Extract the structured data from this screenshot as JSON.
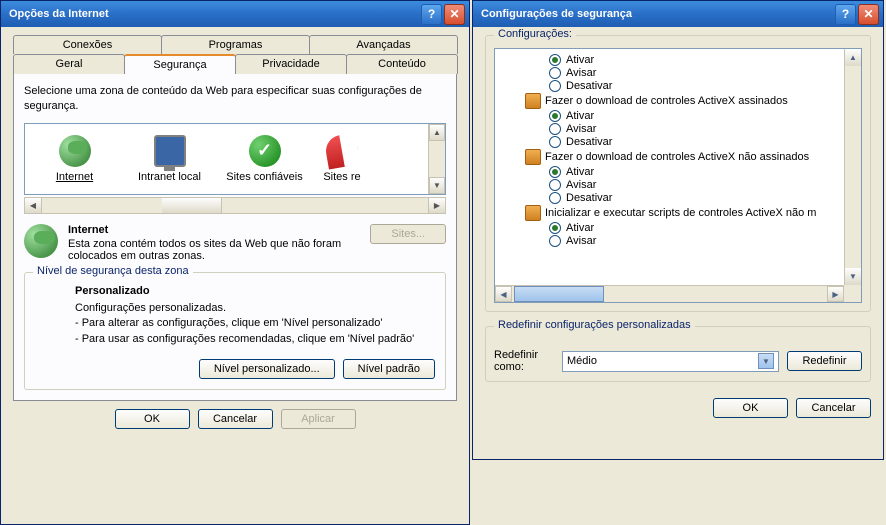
{
  "win1": {
    "title": "Opções da Internet",
    "tabs_top": [
      "Conexões",
      "Programas",
      "Avançadas"
    ],
    "tabs_bottom": [
      "Geral",
      "Segurança",
      "Privacidade",
      "Conteúdo"
    ],
    "zone_instruction": "Selecione uma zona de conteúdo da Web para especificar suas configurações de segurança.",
    "zones": [
      {
        "label": "Internet"
      },
      {
        "label": "Intranet local"
      },
      {
        "label": "Sites confiáveis"
      },
      {
        "label": "Sites re"
      }
    ],
    "zone_selected": {
      "name": "Internet",
      "desc": "Esta zona contém todos os sites da Web que não foram colocados em outras zonas."
    },
    "sites_btn": "Sites...",
    "level_box_title": "Nível de segurança desta zona",
    "level_name": "Personalizado",
    "level_desc1": "Configurações personalizadas.",
    "level_desc2": "- Para alterar as configurações, clique em 'Nível personalizado'",
    "level_desc3": "- Para usar as configurações recomendadas, clique em 'Nível padrão'",
    "btn_custom": "Nível personalizado...",
    "btn_default": "Nível padrão",
    "btn_ok": "OK",
    "btn_cancel": "Cancelar",
    "btn_apply": "Aplicar"
  },
  "win2": {
    "title": "Configurações de segurança",
    "group_title": "Configurações:",
    "options": {
      "opt_enable": "Ativar",
      "opt_warn": "Avisar",
      "opt_disable": "Desativar"
    },
    "categories": [
      {
        "label": "Fazer o download de controles ActiveX assinados",
        "selected": "Ativar"
      },
      {
        "label": "Fazer o download de controles ActiveX não assinados",
        "selected": "Ativar"
      },
      {
        "label": "Inicializar e executar scripts de controles ActiveX não m",
        "selected": "Ativar"
      }
    ],
    "top_orphan_selected": "Ativar",
    "reset_group_title": "Redefinir configurações personalizadas",
    "reset_label": "Redefinir como:",
    "reset_value": "Médio",
    "btn_reset": "Redefinir",
    "btn_ok": "OK",
    "btn_cancel": "Cancelar"
  }
}
